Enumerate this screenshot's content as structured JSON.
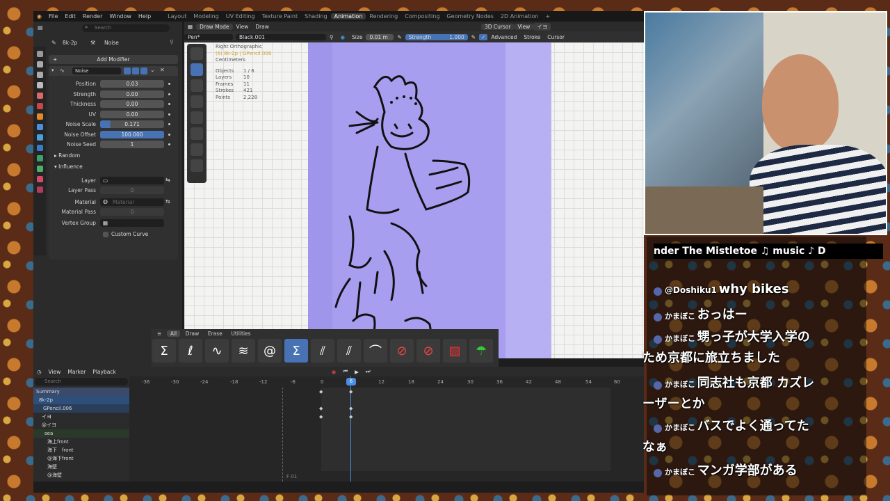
{
  "topbar": {
    "menus": [
      "File",
      "Edit",
      "Render",
      "Window",
      "Help"
    ],
    "workspaces": [
      "Layout",
      "Modeling",
      "UV Editing",
      "Texture Paint",
      "Shading",
      "Animation",
      "Rendering",
      "Compositing",
      "Geometry Nodes",
      "2D Animation"
    ],
    "active": "Animation",
    "plus": "+"
  },
  "props": {
    "search_placeholder": "Search",
    "object": "8k-2p",
    "modifier_name": "Noise",
    "add_modifier": "Add Modifier",
    "panel_name": "Noise",
    "fields": [
      {
        "label": "Position",
        "value": "0.03"
      },
      {
        "label": "Strength",
        "value": "0.00"
      },
      {
        "label": "Thickness",
        "value": "0.00"
      },
      {
        "label": "UV",
        "value": "0.00"
      },
      {
        "label": "Noise Scale",
        "value": "0.171"
      },
      {
        "label": "Noise Offset",
        "value": "100.000"
      },
      {
        "label": "Noise Seed",
        "value": "1"
      }
    ],
    "random": "Random",
    "influence": "Influence",
    "layer": "Layer",
    "layer_pass": "Layer Pass",
    "layer_pass_value": "0",
    "material": "Material",
    "material_placeholder": "Material",
    "material_pass": "Material Pass",
    "material_pass_value": "0",
    "vertex_group": "Vertex Group",
    "custom_curve": "Custom Curve"
  },
  "viewport": {
    "mode": "Draw Mode",
    "view": "View",
    "draw": "Draw",
    "cursor3d": "3D Cursor",
    "view2": "View",
    "layer": "イヨ",
    "brush": "Pen*",
    "material": "Black.001",
    "size_label": "Size",
    "size_value": "0.01 m",
    "strength_label": "Strength",
    "strength_value": "1.000",
    "advanced": "Advanced",
    "stroke": "Stroke",
    "cursor": "Cursor",
    "overlay": [
      "Right Orthographic",
      "(6) 8k-2p | GPencil.006",
      "Centimeters"
    ],
    "stats": [
      {
        "k": "Objects",
        "v": "1 / 6"
      },
      {
        "k": "Layers",
        "v": "10"
      },
      {
        "k": "Frames",
        "v": "11"
      },
      {
        "k": "Strokes",
        "v": "421"
      },
      {
        "k": "Points",
        "v": "2,228"
      }
    ]
  },
  "brushbar": {
    "tabs": [
      "All",
      "Draw",
      "Erase",
      "Utilities"
    ]
  },
  "dope": {
    "view": "View",
    "marker": "Marker",
    "playback": "Playback",
    "search_placeholder": "Search",
    "frame_label": "F 01",
    "ruler": [
      "-36",
      "-30",
      "-24",
      "-18",
      "-12",
      "-6",
      "0",
      "6",
      "12",
      "18",
      "24",
      "30",
      "36",
      "42",
      "48",
      "54",
      "60"
    ],
    "current_frame": "6",
    "channels": [
      "Summary",
      "8k-2p",
      "GPencil.006",
      "イヨ",
      "@イヨ",
      "sea",
      "海上front",
      "海下　front",
      "@海下front",
      "海壁",
      "@海壁"
    ]
  },
  "stream": {
    "ticker": "nder The Mistletoe  ♫ music ♪ D",
    "messages": [
      {
        "name": "@Doshiku1",
        "text": "why bikes",
        "cont": ""
      },
      {
        "name": "かまぼこ",
        "text": "おっはー",
        "cont": ""
      },
      {
        "name": "かまぼこ",
        "text": "甥っ子が大学入学の",
        "cont": "ため京都に旅立ちました"
      },
      {
        "name": "かまぼこ",
        "text": "同志社も京都 カズレ",
        "cont": "ーザーとか"
      },
      {
        "name": "かまぼこ",
        "text": "バスでよく通ってた",
        "cont": "なぁ"
      },
      {
        "name": "かまぼこ",
        "text": "マンガ学部がある",
        "cont": ""
      }
    ]
  }
}
